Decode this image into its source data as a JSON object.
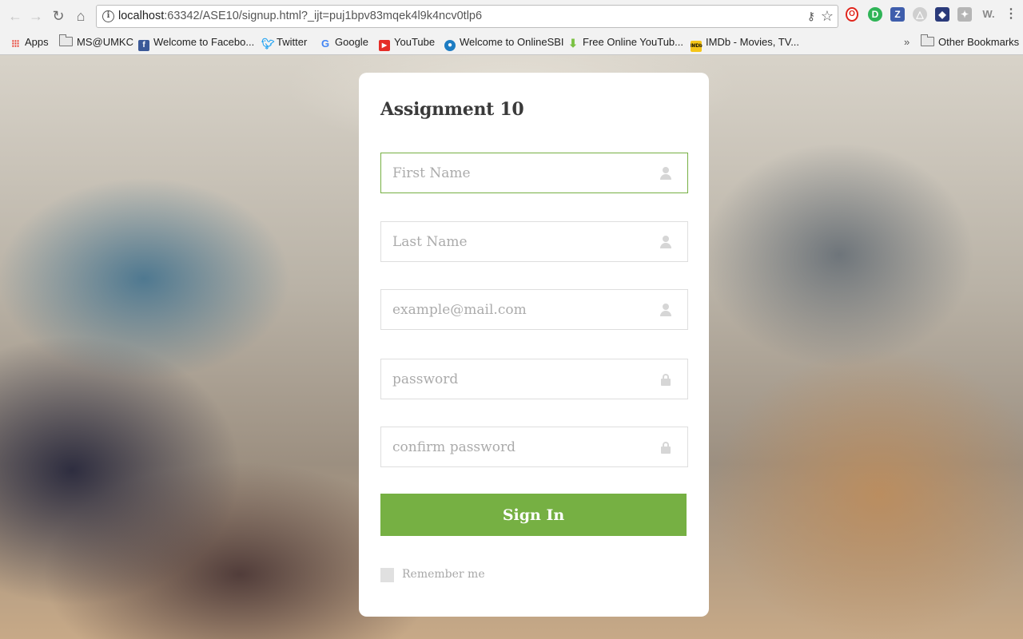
{
  "browser": {
    "url_host": "localhost",
    "url_rest": ":63342/ASE10/signup.html?_ijt=puj1bpv83mqek4l9k4ncv0tlp6",
    "bookmarks": [
      {
        "label": "Apps",
        "icon": "apps-grid-icon"
      },
      {
        "label": "MS@UMKC",
        "icon": "folder-icon"
      },
      {
        "label": "Welcome to Facebo...",
        "icon": "facebook-icon"
      },
      {
        "label": "Twitter",
        "icon": "twitter-icon"
      },
      {
        "label": "Google",
        "icon": "google-icon"
      },
      {
        "label": "YouTube",
        "icon": "youtube-icon"
      },
      {
        "label": "Welcome to OnlineSBI",
        "icon": "sbi-icon"
      },
      {
        "label": "Free Online YouTub...",
        "icon": "download-arrow-icon"
      },
      {
        "label": "IMDb - Movies, TV...",
        "icon": "imdb-icon"
      }
    ],
    "overflow": "»",
    "other_bookmarks": "Other Bookmarks"
  },
  "form": {
    "title": "Assignment 10",
    "first_name_placeholder": "First Name",
    "last_name_placeholder": "Last Name",
    "email_placeholder": "example@mail.com",
    "password_placeholder": "password",
    "confirm_password_placeholder": "confirm password",
    "submit_label": "Sign In",
    "remember_label": "Remember me"
  },
  "colors": {
    "accent": "#76b043",
    "card": "#ffffff"
  }
}
